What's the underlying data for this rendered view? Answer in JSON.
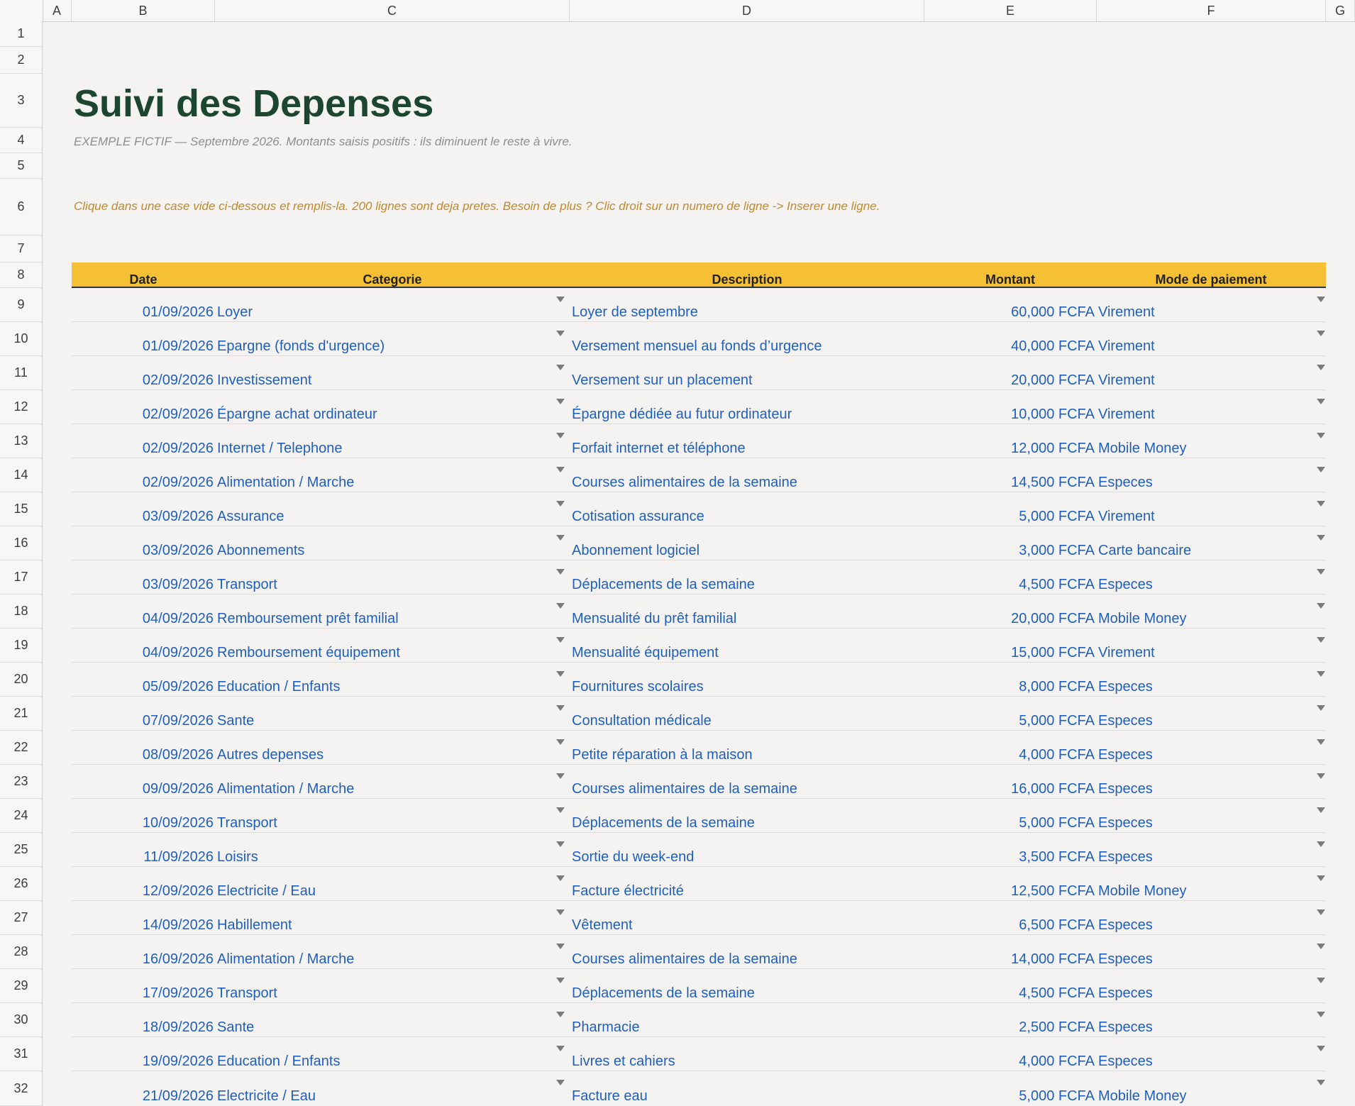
{
  "columns": [
    "A",
    "B",
    "C",
    "D",
    "E",
    "F",
    "G"
  ],
  "rows": [
    "1",
    "2",
    "3",
    "4",
    "5",
    "6",
    "7",
    "8",
    "9",
    "10",
    "11",
    "12",
    "13",
    "14",
    "15",
    "16",
    "17",
    "18",
    "19",
    "20",
    "21",
    "22",
    "23",
    "24",
    "25",
    "26",
    "27",
    "28",
    "29",
    "30",
    "31",
    "32"
  ],
  "title": "Suivi des Depenses",
  "subtitle": "EXEMPLE FICTIF — Septembre 2026. Montants saisis positifs : ils diminuent le reste à vivre.",
  "instructions": "Clique dans une case vide ci-dessous et remplis-la. 200 lignes sont deja pretes. Besoin de plus ? Clic droit sur un numero de ligne -> Inserer une ligne.",
  "headers": {
    "date": "Date",
    "category": "Categorie",
    "description": "Description",
    "amount": "Montant",
    "payment": "Mode de paiement"
  },
  "expenses": [
    {
      "date": "01/09/2026",
      "category": "Loyer",
      "description": "Loyer de septembre",
      "amount": "60,000 FCFA",
      "payment": "Virement"
    },
    {
      "date": "01/09/2026",
      "category": "Epargne (fonds d'urgence)",
      "description": "Versement mensuel au fonds d’urgence",
      "amount": "40,000 FCFA",
      "payment": "Virement"
    },
    {
      "date": "02/09/2026",
      "category": "Investissement",
      "description": "Versement sur un placement",
      "amount": "20,000 FCFA",
      "payment": "Virement"
    },
    {
      "date": "02/09/2026",
      "category": "Épargne achat ordinateur",
      "description": "Épargne dédiée au futur ordinateur",
      "amount": "10,000 FCFA",
      "payment": "Virement"
    },
    {
      "date": "02/09/2026",
      "category": "Internet / Telephone",
      "description": "Forfait internet et téléphone",
      "amount": "12,000 FCFA",
      "payment": "Mobile Money"
    },
    {
      "date": "02/09/2026",
      "category": "Alimentation / Marche",
      "description": "Courses alimentaires de la semaine",
      "amount": "14,500 FCFA",
      "payment": "Especes"
    },
    {
      "date": "03/09/2026",
      "category": "Assurance",
      "description": "Cotisation assurance",
      "amount": "5,000 FCFA",
      "payment": "Virement"
    },
    {
      "date": "03/09/2026",
      "category": "Abonnements",
      "description": "Abonnement logiciel",
      "amount": "3,000 FCFA",
      "payment": "Carte bancaire"
    },
    {
      "date": "03/09/2026",
      "category": "Transport",
      "description": "Déplacements de la semaine",
      "amount": "4,500 FCFA",
      "payment": "Especes"
    },
    {
      "date": "04/09/2026",
      "category": "Remboursement prêt familial",
      "description": "Mensualité du prêt familial",
      "amount": "20,000 FCFA",
      "payment": "Mobile Money"
    },
    {
      "date": "04/09/2026",
      "category": "Remboursement équipement",
      "description": "Mensualité équipement",
      "amount": "15,000 FCFA",
      "payment": "Virement"
    },
    {
      "date": "05/09/2026",
      "category": "Education / Enfants",
      "description": "Fournitures scolaires",
      "amount": "8,000 FCFA",
      "payment": "Especes"
    },
    {
      "date": "07/09/2026",
      "category": "Sante",
      "description": "Consultation médicale",
      "amount": "5,000 FCFA",
      "payment": "Especes"
    },
    {
      "date": "08/09/2026",
      "category": "Autres depenses",
      "description": "Petite réparation à la maison",
      "amount": "4,000 FCFA",
      "payment": "Especes"
    },
    {
      "date": "09/09/2026",
      "category": "Alimentation / Marche",
      "description": "Courses alimentaires de la semaine",
      "amount": "16,000 FCFA",
      "payment": "Especes"
    },
    {
      "date": "10/09/2026",
      "category": "Transport",
      "description": "Déplacements de la semaine",
      "amount": "5,000 FCFA",
      "payment": "Especes"
    },
    {
      "date": "11/09/2026",
      "category": "Loisirs",
      "description": "Sortie du week-end",
      "amount": "3,500 FCFA",
      "payment": "Especes"
    },
    {
      "date": "12/09/2026",
      "category": "Electricite / Eau",
      "description": "Facture électricité",
      "amount": "12,500 FCFA",
      "payment": "Mobile Money"
    },
    {
      "date": "14/09/2026",
      "category": "Habillement",
      "description": "Vêtement",
      "amount": "6,500 FCFA",
      "payment": "Especes"
    },
    {
      "date": "16/09/2026",
      "category": "Alimentation / Marche",
      "description": "Courses alimentaires de la semaine",
      "amount": "14,000 FCFA",
      "payment": "Especes"
    },
    {
      "date": "17/09/2026",
      "category": "Transport",
      "description": "Déplacements de la semaine",
      "amount": "4,500 FCFA",
      "payment": "Especes"
    },
    {
      "date": "18/09/2026",
      "category": "Sante",
      "description": "Pharmacie",
      "amount": "2,500 FCFA",
      "payment": "Especes"
    },
    {
      "date": "19/09/2026",
      "category": "Education / Enfants",
      "description": "Livres et cahiers",
      "amount": "4,000 FCFA",
      "payment": "Especes"
    },
    {
      "date": "21/09/2026",
      "category": "Electricite / Eau",
      "description": "Facture eau",
      "amount": "5,000 FCFA",
      "payment": "Mobile Money"
    }
  ]
}
